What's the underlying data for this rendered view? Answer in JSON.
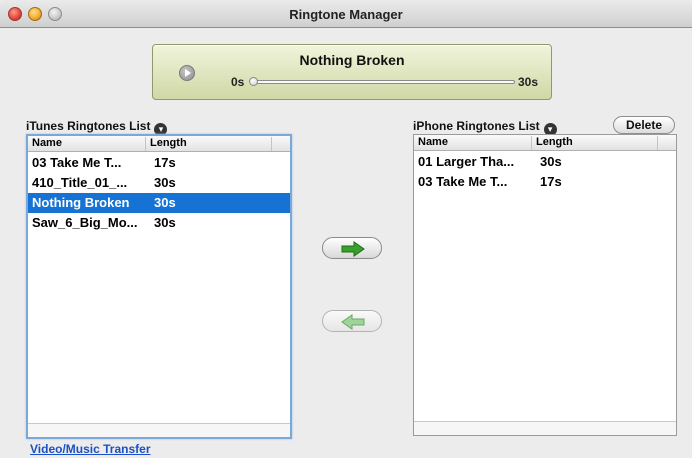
{
  "window": {
    "title": "Ringtone Manager"
  },
  "player": {
    "now_playing": "Nothing Broken",
    "time_start": "0s",
    "time_end": "30s",
    "progress": 0
  },
  "itunes_list": {
    "label": "iTunes Ringtones List",
    "columns": [
      "Name",
      "Length"
    ],
    "rows": [
      {
        "name": "03 Take Me T...",
        "length": "17s",
        "selected": false
      },
      {
        "name": "410_Title_01_...",
        "length": "30s",
        "selected": false
      },
      {
        "name": "Nothing Broken",
        "length": "30s",
        "selected": true
      },
      {
        "name": "Saw_6_Big_Mo...",
        "length": "30s",
        "selected": false
      }
    ]
  },
  "iphone_list": {
    "label": "iPhone Ringtones List",
    "columns": [
      "Name",
      "Length"
    ],
    "rows": [
      {
        "name": "01 Larger Tha...",
        "length": "30s",
        "selected": false
      },
      {
        "name": "03 Take Me T...",
        "length": "17s",
        "selected": false
      }
    ]
  },
  "actions": {
    "delete_label": "Delete",
    "transfer_right_icon": "arrow-right-icon",
    "transfer_left_icon": "arrow-left-icon"
  },
  "footer": {
    "link_label": "Video/Music Transfer"
  },
  "colors": {
    "selection": "#1673d4",
    "arrow_active": "#3aa02c",
    "arrow_disabled": "#9fd39a"
  }
}
